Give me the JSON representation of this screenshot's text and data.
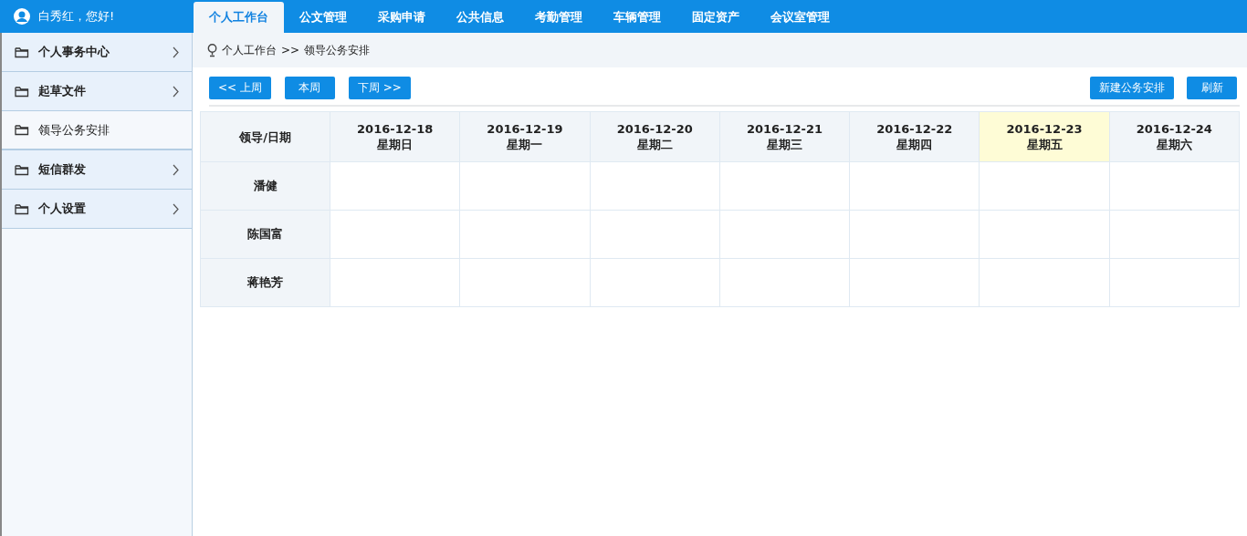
{
  "user": {
    "greeting": "白秀红，您好!"
  },
  "tabs": [
    {
      "label": "个人工作台",
      "selected": true
    },
    {
      "label": "公文管理",
      "selected": false
    },
    {
      "label": "采购申请",
      "selected": false
    },
    {
      "label": "公共信息",
      "selected": false
    },
    {
      "label": "考勤管理",
      "selected": false
    },
    {
      "label": "车辆管理",
      "selected": false
    },
    {
      "label": "固定资产",
      "selected": false
    },
    {
      "label": "会议室管理",
      "selected": false
    }
  ],
  "sidebar": {
    "items": [
      {
        "label": "个人事务中心",
        "selected": false,
        "has_submenu": true
      },
      {
        "label": "起草文件",
        "selected": false,
        "has_submenu": true
      },
      {
        "label": "领导公务安排",
        "selected": true,
        "has_submenu": false
      },
      {
        "label": "短信群发",
        "selected": false,
        "has_submenu": true
      },
      {
        "label": "个人设置",
        "selected": false,
        "has_submenu": true
      }
    ]
  },
  "breadcrumb": [
    "个人工作台",
    ">>",
    "领导公务安排"
  ],
  "toolbar": {
    "left": [
      "<< 上周",
      "本周",
      "下周 >>"
    ],
    "right": [
      "新建公务安排",
      "刷新"
    ]
  },
  "table": {
    "corner": "领导/日期",
    "days": [
      {
        "date": "2016-12-18",
        "weekday": "星期日",
        "today": false
      },
      {
        "date": "2016-12-19",
        "weekday": "星期一",
        "today": false
      },
      {
        "date": "2016-12-20",
        "weekday": "星期二",
        "today": false
      },
      {
        "date": "2016-12-21",
        "weekday": "星期三",
        "today": false
      },
      {
        "date": "2016-12-22",
        "weekday": "星期四",
        "today": false
      },
      {
        "date": "2016-12-23",
        "weekday": "星期五",
        "today": true
      },
      {
        "date": "2016-12-24",
        "weekday": "星期六",
        "today": false
      }
    ],
    "rows": [
      {
        "leader": "潘健"
      },
      {
        "leader": "陈国富"
      },
      {
        "leader": "蒋艳芳"
      }
    ]
  }
}
